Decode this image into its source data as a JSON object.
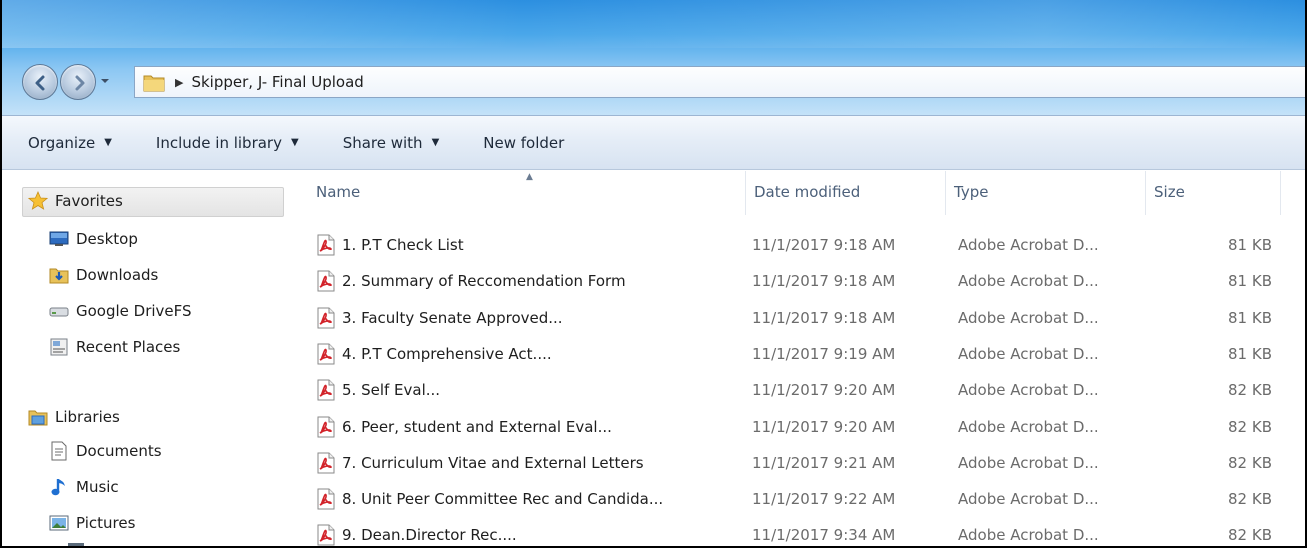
{
  "address": {
    "crumb": "Skipper, J- Final Upload"
  },
  "toolbar": {
    "organize": "Organize",
    "include_library": "Include in library",
    "share_with": "Share with",
    "new_folder": "New folder"
  },
  "navpane": {
    "favorites": {
      "label": "Favorites",
      "items": [
        {
          "label": "Desktop",
          "icon": "desktop-icon"
        },
        {
          "label": "Downloads",
          "icon": "downloads-folder-icon"
        },
        {
          "label": "Google DriveFS",
          "icon": "drive-icon"
        },
        {
          "label": "Recent Places",
          "icon": "recent-places-icon"
        }
      ]
    },
    "libraries": {
      "label": "Libraries",
      "items": [
        {
          "label": "Documents",
          "icon": "document-icon"
        },
        {
          "label": "Music",
          "icon": "music-icon"
        },
        {
          "label": "Pictures",
          "icon": "pictures-icon"
        }
      ]
    }
  },
  "columns": {
    "name": "Name",
    "date": "Date modified",
    "type": "Type",
    "size": "Size"
  },
  "files": [
    {
      "name": "1. P.T Check List",
      "date": "11/1/2017 9:18 AM",
      "type": "Adobe Acrobat D...",
      "size": "81 KB"
    },
    {
      "name": "2. Summary of Reccomendation Form",
      "date": "11/1/2017 9:18 AM",
      "type": "Adobe Acrobat D...",
      "size": "81 KB"
    },
    {
      "name": "3. Faculty Senate Approved...",
      "date": "11/1/2017 9:18 AM",
      "type": "Adobe Acrobat D...",
      "size": "81 KB"
    },
    {
      "name": "4. P.T Comprehensive Act....",
      "date": "11/1/2017 9:19 AM",
      "type": "Adobe Acrobat D...",
      "size": "81 KB"
    },
    {
      "name": "5. Self Eval...",
      "date": "11/1/2017 9:20 AM",
      "type": "Adobe Acrobat D...",
      "size": "82 KB"
    },
    {
      "name": "6. Peer, student and External Eval...",
      "date": "11/1/2017 9:20 AM",
      "type": "Adobe Acrobat D...",
      "size": "82 KB"
    },
    {
      "name": "7. Curriculum Vitae and External Letters",
      "date": "11/1/2017 9:21 AM",
      "type": "Adobe Acrobat D...",
      "size": "82 KB"
    },
    {
      "name": "8. Unit Peer Committee Rec and Candida...",
      "date": "11/1/2017 9:22 AM",
      "type": "Adobe Acrobat D...",
      "size": "82 KB"
    },
    {
      "name": "9. Dean.Director Rec....",
      "date": "11/1/2017 9:34 AM",
      "type": "Adobe Acrobat D...",
      "size": "82 KB"
    }
  ]
}
